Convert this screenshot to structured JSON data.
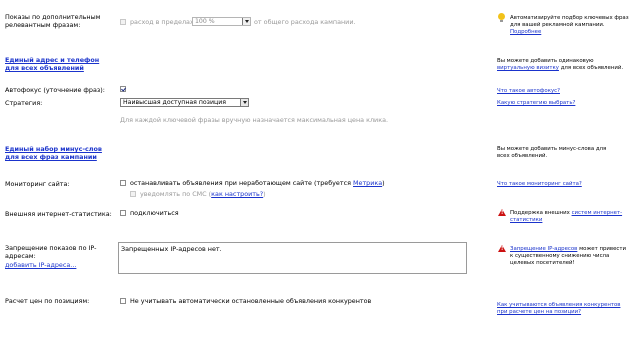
{
  "rows": {
    "additional_phrases": {
      "label": "Показы по дополнительным релевантным фразам:",
      "checkbox_text": "расход в пределах",
      "percent_value": "100 %",
      "suffix": "от общего расхода кампании.",
      "right_text": "Автоматизируйте подбор ключевых фраз для вашей рекламной кампании.",
      "right_link": "Подробнее"
    },
    "address_phone": {
      "link": "Единый адрес и телефон для всех объявлений",
      "right_text_1": "Вы можете добавить одинаковую",
      "right_link": "виртуальную визитку",
      "right_text_2": "для всех объявлений."
    },
    "autofocus": {
      "label": "Автофокус (уточнение фраз):",
      "right_link": "Что такое автофокус?"
    },
    "strategy": {
      "label": "Стратегия:",
      "selected": "Наивысшая доступная позиция",
      "hint": "Для каждой ключевой фразы вручную назначается максимальная цена клика.",
      "right_link": "Какую стратегию выбрать?"
    },
    "minus_words": {
      "link": "Единый набор минус-слов для всех фраз кампании",
      "right_text": "Вы можете добавить минус-слова для всех объявлений."
    },
    "monitoring": {
      "label": "Мониторинг сайта:",
      "option_text": "останавливать объявления при неработающем сайте (требуется",
      "option_link": "Метрика",
      "option_close": ")",
      "sms_text": "уведомлять по СМС (",
      "sms_link": "как настроить?",
      "sms_close": ")",
      "right_link": "Что такое мониторинг сайта?"
    },
    "external_stats": {
      "label": "Внешняя интернет-статистика:",
      "option_text": "подключиться",
      "right_text": "Поддержка внешних",
      "right_link": "систем интернет-статистики"
    },
    "ip_ban": {
      "label": "Запрещение показов по IP-адресам:",
      "add_link": "добавить IP-адреса...",
      "textarea_value": "Запрещенных IP-адресов нет.",
      "right_link": "Запрещение IP-адресов",
      "right_text": "может привести к существенному снижению числа целевых посетителей!"
    },
    "position_price": {
      "label": "Расчет цен по позициям:",
      "option_text": "Не учитывать автоматически остановленные объявления конкурентов",
      "right_link": "Как учитываются объявления конкурентов при расчете цен на позиции?"
    }
  },
  "colors": {
    "link": "#1a33cc",
    "warning": "#cc1111",
    "bulb": "#f2c21a"
  },
  "icons": [
    "lightbulb-icon",
    "warning-icon"
  ]
}
